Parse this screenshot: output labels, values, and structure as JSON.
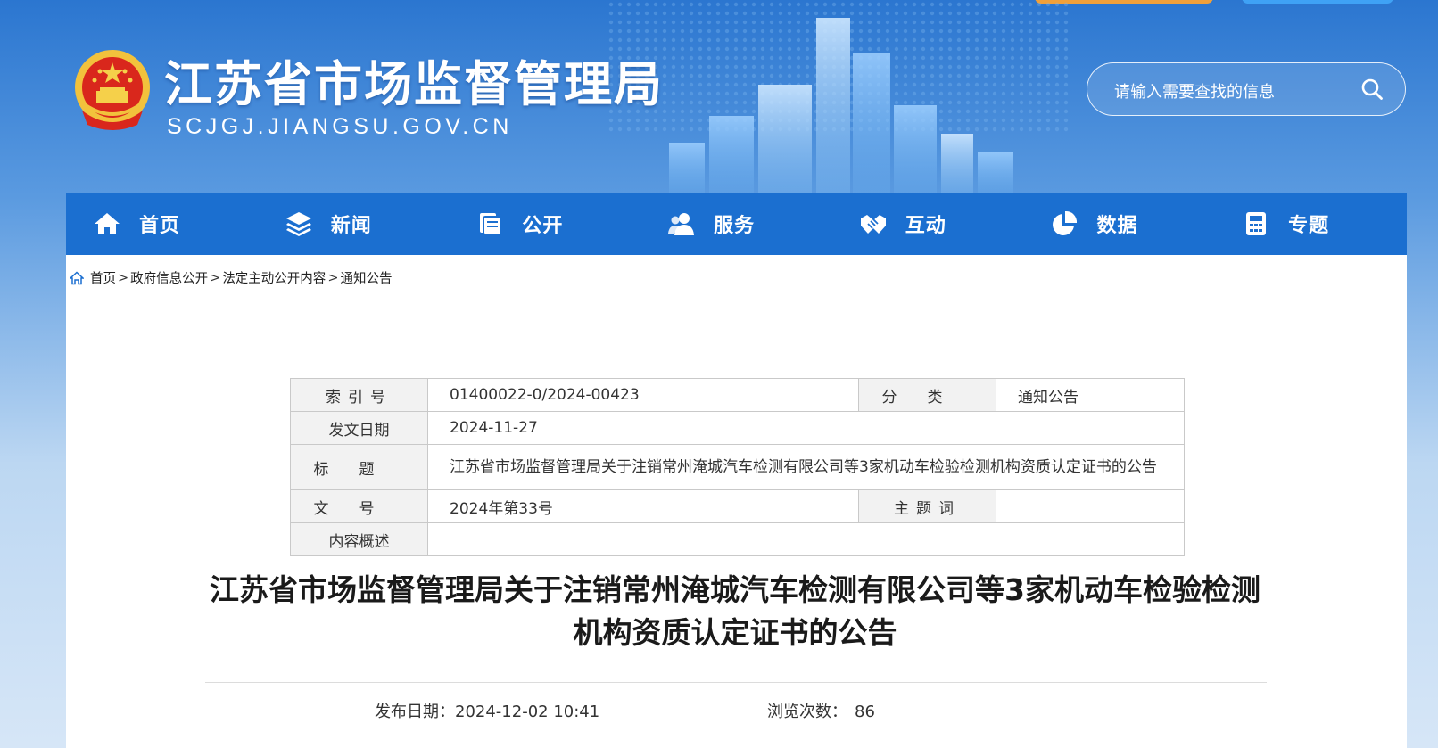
{
  "header": {
    "site_name": "江苏省市场监督管理局",
    "site_domain": "SCJGJ.JIANGSU.GOV.CN",
    "search_placeholder": "请输入需要查找的信息"
  },
  "nav": {
    "items": [
      {
        "label": "首页",
        "icon": "home-icon"
      },
      {
        "label": "新闻",
        "icon": "layers-icon"
      },
      {
        "label": "公开",
        "icon": "document-stack-icon"
      },
      {
        "label": "服务",
        "icon": "user-group-icon"
      },
      {
        "label": "互动",
        "icon": "handshake-icon"
      },
      {
        "label": "数据",
        "icon": "pie-chart-icon"
      },
      {
        "label": "专题",
        "icon": "calculator-icon"
      }
    ]
  },
  "breadcrumb": {
    "items": [
      "首页",
      "政府信息公开",
      "法定主动公开内容",
      "通知公告"
    ],
    "separator": ">"
  },
  "meta": {
    "index_label": "索引号",
    "index_value": "01400022-0/2024-00423",
    "category_label": "分类",
    "category_value": "通知公告",
    "date_label": "发文日期",
    "date_value": "2024-11-27",
    "title_label": "标题",
    "title_value": "江苏省市场监督管理局关于注销常州淹城汽车检测有限公司等3家机动车检验检测机构资质认定证书的公告",
    "docno_label": "文号",
    "docno_value": "2024年第33号",
    "keywords_label": "主题词",
    "keywords_value": "",
    "summary_label": "内容概述",
    "summary_value": ""
  },
  "article": {
    "title": "江苏省市场监督管理局关于注销常州淹城汽车检测有限公司等3家机动车检验检测机构资质认定证书的公告",
    "publish_label": "发布日期：",
    "publish_value": "2024-12-02 10:41",
    "views_label": "浏览次数：",
    "views_value": "86"
  },
  "colors": {
    "header_blue": "#2b76d0",
    "nav_blue": "#1b6fd0",
    "accent_orange": "#f0a03a"
  }
}
